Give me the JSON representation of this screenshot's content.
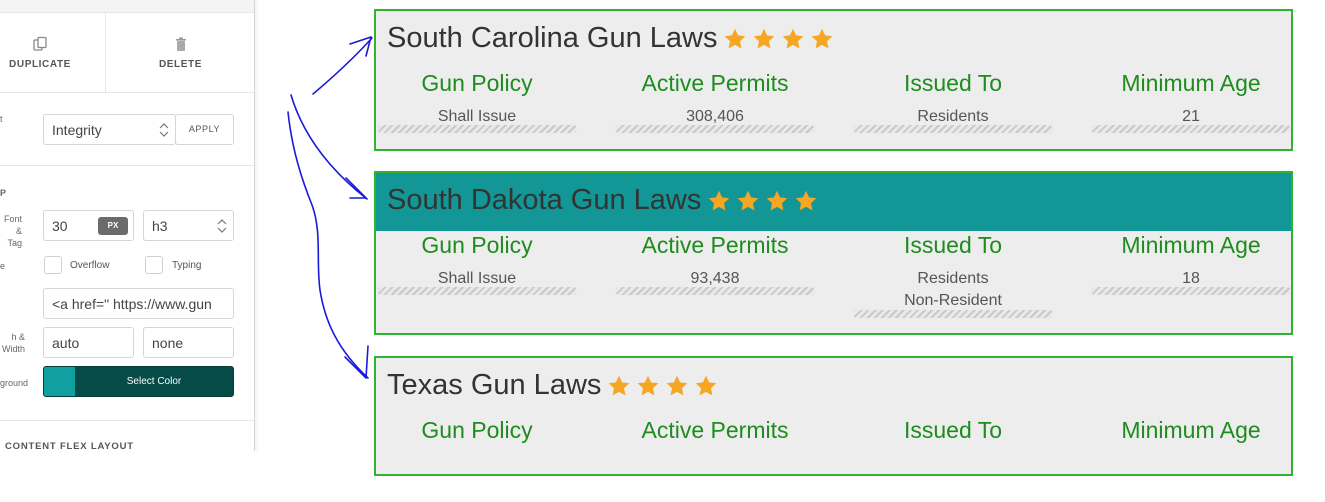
{
  "panel": {
    "duplicate_label": "DUPLICATE",
    "delete_label": "DELETE",
    "preset_label_partial": "t",
    "preset_value": "Integrity",
    "apply_label": "APPLY",
    "group_label_partial": "P",
    "font_label_partial_1": "Font",
    "font_label_partial_2": "& Tag",
    "font_size": "30",
    "font_unit": "PX",
    "tag_value": "h3",
    "style_label_partial": "e",
    "overflow_label": "Overflow",
    "typing_label": "Typing",
    "link_value": "<a href=\"  https://www.gun",
    "width_label_partial_1": "h &",
    "width_label_partial_2": "Width",
    "width_value": "auto",
    "maxwidth_value": "none",
    "background_label_partial": "ground",
    "select_color_label": "Select Color",
    "swatch_color": "#11a0a0",
    "section_label": "CONTENT FLEX LAYOUT"
  },
  "cards": [
    {
      "title": "South Carolina Gun Laws",
      "rating": 4,
      "active": false,
      "columns": [
        {
          "heading": "Gun Policy",
          "value": "Shall Issue"
        },
        {
          "heading": "Active Permits",
          "value": "308,406"
        },
        {
          "heading": "Issued To",
          "value": "Residents"
        },
        {
          "heading": "Minimum Age",
          "value": "21"
        }
      ]
    },
    {
      "title": "South Dakota Gun Laws",
      "rating": 4,
      "active": true,
      "columns": [
        {
          "heading": "Gun Policy",
          "value": "Shall Issue"
        },
        {
          "heading": "Active Permits",
          "value": "93,438"
        },
        {
          "heading": "Issued To",
          "value": "Residents",
          "value2": "Non-Resident"
        },
        {
          "heading": "Minimum Age",
          "value": "18"
        }
      ]
    },
    {
      "title": "Texas Gun Laws",
      "rating": 4,
      "active": false,
      "columns": [
        {
          "heading": "Gun Policy",
          "value": ""
        },
        {
          "heading": "Active Permits",
          "value": ""
        },
        {
          "heading": "Issued To",
          "value": ""
        },
        {
          "heading": "Minimum Age",
          "value": ""
        }
      ]
    }
  ],
  "colors": {
    "card_border": "#2fb42f",
    "heading_green": "#1e8c1e",
    "active_header": "#129696",
    "star": "#f5a623",
    "annotation_ink": "#1a1adc"
  }
}
